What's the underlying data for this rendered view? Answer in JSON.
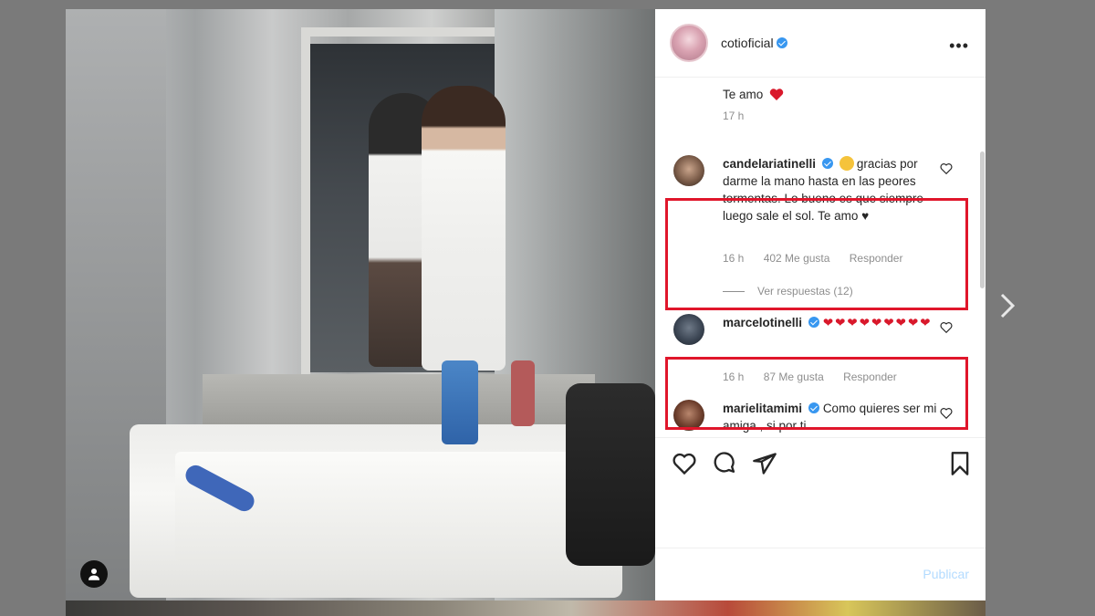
{
  "post": {
    "account": "cotioficial",
    "more_label": "•••"
  },
  "comments": {
    "previous": {
      "text": "Te amo",
      "time": "17 h"
    },
    "items": [
      {
        "user": "candelariatinelli",
        "text": "gracias por darme la mano hasta en las peores tormentas. Lo bueno es que siempre luego sale el sol. Te amo ♥",
        "time": "16 h",
        "likes": "402 Me gusta",
        "reply": "Responder",
        "view_replies": "Ver respuestas (12)"
      },
      {
        "user": "marcelotinelli",
        "text": "❤❤❤❤❤❤❤❤❤",
        "time": "16 h",
        "likes": "87 Me gusta",
        "reply": "Responder"
      },
      {
        "user": "marielitamimi",
        "text": "Como quieres ser mi amiga , si por ti"
      }
    ]
  },
  "composer": {
    "publish_label": "Publicar"
  },
  "colors": {
    "highlight": "#e0162b",
    "verified": "#3897f0",
    "heart": "#d9182b",
    "publish_disabled": "#b3dbff"
  },
  "icons": [
    "user-tag-icon",
    "more-icon",
    "verified-icon",
    "heart-icon",
    "comment-icon",
    "share-icon",
    "bookmark-icon",
    "next-arrow-icon"
  ]
}
